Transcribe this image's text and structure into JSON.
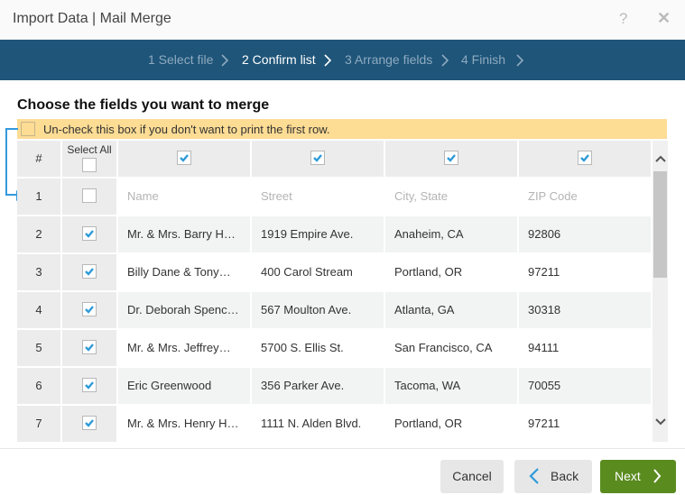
{
  "window": {
    "title": "Import Data | Mail Merge",
    "help_label": "?",
    "close_label": "✕"
  },
  "steps": [
    {
      "label": "1 Select file",
      "active": false
    },
    {
      "label": "2 Confirm list",
      "active": true
    },
    {
      "label": "3 Arrange fields",
      "active": false
    },
    {
      "label": "4 Finish",
      "active": false
    }
  ],
  "heading": "Choose the fields you want to merge",
  "banner": {
    "text": "Un-check this box if you don't want to print the first row.",
    "checked": false
  },
  "grid": {
    "num_header": "#",
    "select_all_label": "Select All",
    "select_all_checked": false,
    "column_checks": [
      true,
      true,
      true,
      true
    ],
    "rows": [
      {
        "num": "1",
        "checked": false,
        "cells": [
          "Name",
          "Street",
          "City, State",
          "ZIP Code"
        ]
      },
      {
        "num": "2",
        "checked": true,
        "cells": [
          "Mr. & Mrs. Barry H…",
          "1919 Empire Ave.",
          "Anaheim, CA",
          "92806"
        ]
      },
      {
        "num": "3",
        "checked": true,
        "cells": [
          "Billy Dane & Tony…",
          "400 Carol Stream",
          "Portland, OR",
          "97211"
        ]
      },
      {
        "num": "4",
        "checked": true,
        "cells": [
          "Dr. Deborah Spenc…",
          "567 Moulton Ave.",
          "Atlanta, GA",
          "30318"
        ]
      },
      {
        "num": "5",
        "checked": true,
        "cells": [
          "Mr. & Mrs. Jeffrey…",
          "5700 S. Ellis St.",
          "San Francisco, CA",
          "94111"
        ]
      },
      {
        "num": "6",
        "checked": true,
        "cells": [
          "Eric Greenwood",
          "356 Parker Ave.",
          "Tacoma, WA",
          "70055"
        ]
      },
      {
        "num": "7",
        "checked": true,
        "cells": [
          "Mr. & Mrs. Henry H…",
          "1111 N. Alden Blvd.",
          "Portland, OR",
          "97211"
        ]
      }
    ]
  },
  "footer": {
    "cancel_label": "Cancel",
    "back_label": "Back",
    "next_label": "Next"
  },
  "colors": {
    "steps_bar": "#1f5579",
    "banner": "#fddc94",
    "check": "#2e9ad8",
    "next_button": "#5a8b1f"
  }
}
